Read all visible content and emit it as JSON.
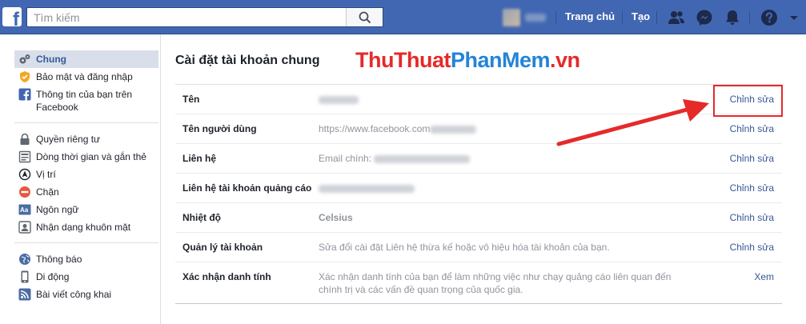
{
  "topbar": {
    "logo": "f",
    "search_placeholder": "Tìm kiếm",
    "nav_home": "Trang chủ",
    "nav_create": "Tạo",
    "icons": [
      "friends-icon",
      "messenger-icon",
      "notifications-icon",
      "help-icon",
      "chevron-down-icon"
    ],
    "bg_color": "#4267b2"
  },
  "sidebar": {
    "groups": [
      [
        {
          "label": "Chung",
          "icon": "gear-icon",
          "active": true
        },
        {
          "label": "Bảo mật và đăng nhập",
          "icon": "badge-icon"
        },
        {
          "label": "Thông tin của bạn trên Facebook",
          "icon": "facebook-icon"
        }
      ],
      [
        {
          "label": "Quyền riêng tư",
          "icon": "lock-icon"
        },
        {
          "label": "Dòng thời gian và gắn thẻ",
          "icon": "timeline-icon"
        },
        {
          "label": "Vị trí",
          "icon": "location-icon"
        },
        {
          "label": "Chặn",
          "icon": "block-icon"
        },
        {
          "label": "Ngôn ngữ",
          "icon": "language-icon"
        },
        {
          "label": "Nhận dạng khuôn mặt",
          "icon": "face-icon"
        }
      ],
      [
        {
          "label": "Thông báo",
          "icon": "globe-icon"
        },
        {
          "label": "Di động",
          "icon": "mobile-icon"
        },
        {
          "label": "Bài viết công khai",
          "icon": "rss-icon"
        }
      ]
    ]
  },
  "main": {
    "title": "Cài đặt tài khoản chung",
    "watermark": {
      "part1": "ThuThuat",
      "part2": "PhanMem",
      "part3": ".vn"
    },
    "rows": [
      {
        "label": "Tên",
        "value": "",
        "action": "Chỉnh sửa"
      },
      {
        "label": "Tên người dùng",
        "value": "https://www.facebook.com",
        "action": "Chỉnh sửa"
      },
      {
        "label": "Liên hệ",
        "value": "Email chính:",
        "action": "Chỉnh sửa"
      },
      {
        "label": "Liên hệ tài khoản quảng cáo",
        "value": "",
        "action": "Chỉnh sửa"
      },
      {
        "label": "Nhiệt độ",
        "value": "Celsius",
        "action": "Chỉnh sửa"
      },
      {
        "label": "Quản lý tài khoản",
        "value": "Sửa đổi cài đặt Liên hệ thừa kế hoặc vô hiệu hóa tài khoản của bạn.",
        "action": "Chỉnh sửa"
      },
      {
        "label": "Xác nhận danh tính",
        "value": "Xác nhận danh tính của bạn để làm những việc như chạy quảng cáo liên quan đến chính trị và các vấn đề quan trọng của quốc gia.",
        "action": "Xem"
      }
    ],
    "accent_color": "#365899",
    "annotation_color": "#e52a2a"
  }
}
